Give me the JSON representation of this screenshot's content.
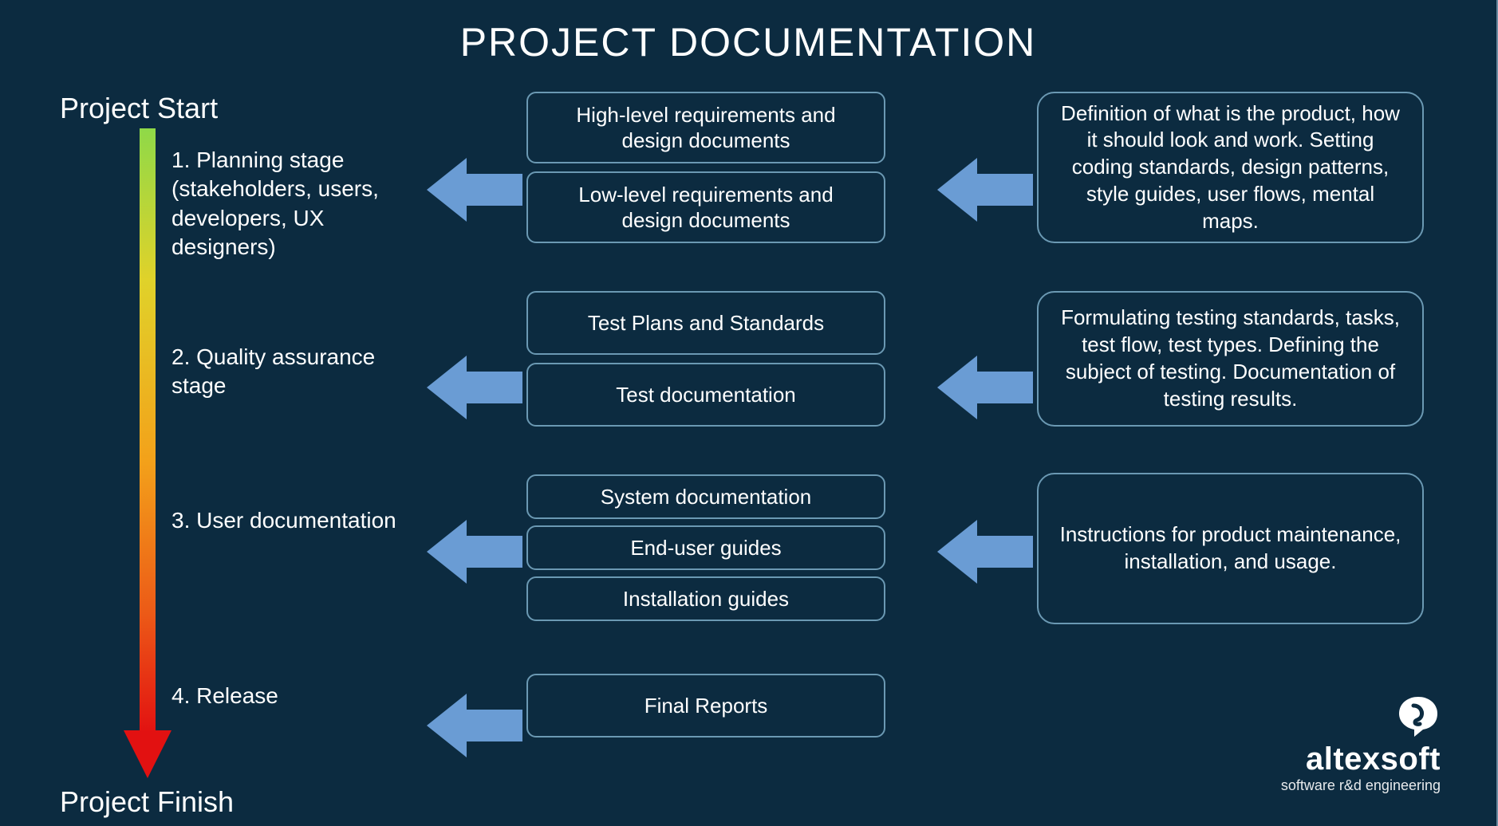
{
  "title": "PROJECT DOCUMENTATION",
  "timeline": {
    "start": "Project Start",
    "finish": "Project Finish",
    "stages": [
      "1. Planning stage (stakeholders, users, developers, UX designers)",
      "2. Quality assurance stage",
      "3. User documentation",
      "4. Release"
    ]
  },
  "boxes": {
    "r1a": "High-level requirements and design documents",
    "r1b": "Low-level requirements and design documents",
    "r2a": "Test Plans and Standards",
    "r2b": "Test documentation",
    "r3a": "System documentation",
    "r3b": "End-user guides",
    "r3c": "Installation guides",
    "r4a": "Final Reports"
  },
  "descriptions": {
    "d1": "Definition of what is the product, how it should look and work. Setting coding standards, design patterns, style guides, user flows, mental maps.",
    "d2": "Formulating testing standards, tasks, test flow, test types. Defining the subject of testing. Documentation of testing results.",
    "d3": "Instructions for product maintenance, installation, and usage."
  },
  "logo": {
    "brand": "altexsoft",
    "sub": "software r&d engineering"
  }
}
